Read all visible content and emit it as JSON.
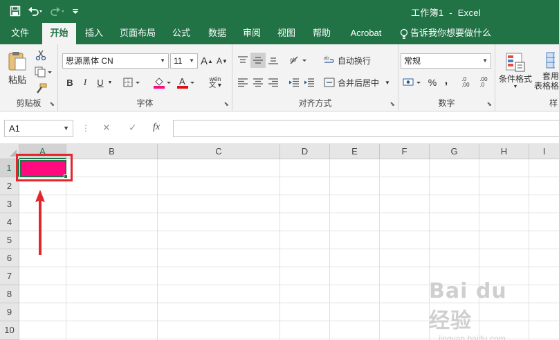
{
  "titlebar": {
    "title": "工作簿1  -  Excel",
    "qat": {
      "save_icon": "save-icon",
      "undo_icon": "undo-icon",
      "redo_icon": "redo-icon",
      "customize_icon": "customize-qat-icon"
    }
  },
  "tabs": [
    {
      "label": "文件",
      "active": false
    },
    {
      "label": "开始",
      "active": true
    },
    {
      "label": "插入",
      "active": false
    },
    {
      "label": "页面布局",
      "active": false
    },
    {
      "label": "公式",
      "active": false
    },
    {
      "label": "数据",
      "active": false
    },
    {
      "label": "审阅",
      "active": false
    },
    {
      "label": "视图",
      "active": false
    },
    {
      "label": "帮助",
      "active": false
    },
    {
      "label": "Acrobat",
      "active": false
    }
  ],
  "tell_me": "告诉我你想要做什么",
  "ribbon": {
    "clipboard": {
      "paste_label": "粘贴",
      "group_label": "剪贴板"
    },
    "font": {
      "font_name": "思源黑体 CN",
      "font_size": "11",
      "bold": "B",
      "italic": "I",
      "underline": "U",
      "grow_font": "A",
      "shrink_font": "A",
      "phonetic": "wén",
      "group_label": "字体"
    },
    "alignment": {
      "wrap_text": "自动换行",
      "merge_center": "合并后居中",
      "group_label": "对齐方式"
    },
    "number": {
      "format": "常规",
      "percent": "%",
      "comma": ",",
      "inc_decimal": ".0\n.00",
      "dec_decimal": ".00\n.0",
      "group_label": "数字"
    },
    "styles": {
      "conditional_format": "条件格式",
      "table_format": "套用\n表格格",
      "group_label": "样"
    }
  },
  "formula_bar": {
    "name_box": "A1",
    "fx": "fx",
    "cancel": "✕",
    "enter": "✓",
    "value": ""
  },
  "grid": {
    "columns": [
      "A",
      "B",
      "C",
      "D",
      "E",
      "F",
      "G",
      "H",
      "I"
    ],
    "rows": [
      "1",
      "2",
      "3",
      "4",
      "5",
      "6",
      "7",
      "8",
      "9",
      "10"
    ],
    "active_cell": "A1",
    "a1_fill": "#ff0a7f",
    "accent": "#217346",
    "annotation_color": "#e3262b"
  },
  "watermark": {
    "logo": "Bai du 经验",
    "url": "jingyan.baidu.com"
  }
}
